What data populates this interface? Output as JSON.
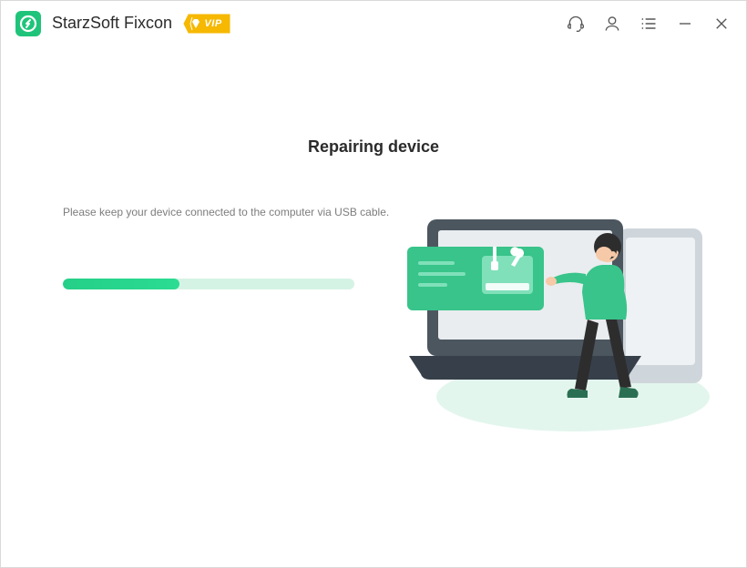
{
  "titlebar": {
    "app_name": "StarzSoft Fixcon",
    "vip_label": "VIP"
  },
  "main": {
    "heading": "Repairing device",
    "instruction": "Please keep your device connected to the computer via USB cable.",
    "progress_percent": 40
  },
  "colors": {
    "accent": "#1fc47a",
    "vip_badge": "#f6b800",
    "progress_track": "#d5f3e5"
  }
}
